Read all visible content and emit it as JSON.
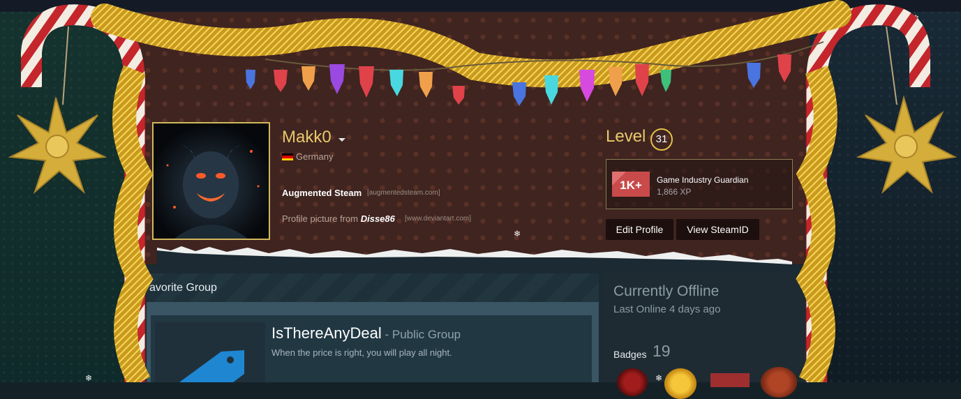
{
  "profile": {
    "persona_name": "Makk0",
    "country": "Germany",
    "summary_title": "Augmented Steam",
    "summary_title_link": "[augmentedsteam.com]",
    "profile_picture_prefix": "Profile picture from",
    "profile_picture_artist": "Disse86",
    "profile_picture_link": "[www.deviantart.com]"
  },
  "level": {
    "label": "Level",
    "value": "31"
  },
  "featured_badge": {
    "icon_text": "1K+",
    "name": "Game Industry Guardian",
    "xp": "1,866 XP"
  },
  "buttons": {
    "edit_profile": "Edit Profile",
    "view_steamid": "View SteamID"
  },
  "favorite_group": {
    "section_title": "avorite Group",
    "name": "IsThereAnyDeal",
    "type": " - Public Group",
    "description": "When the price is right, you will play all night."
  },
  "status": {
    "state": "Currently Offline",
    "last_online": "Last Online 4 days ago"
  },
  "badges": {
    "label": "Badges",
    "count": "19"
  },
  "colors": {
    "accent_gold": "#e7c96b",
    "header_brown": "#3f2420",
    "content_bg": "#1b2a33"
  },
  "icons": {
    "snowflake": "❄"
  }
}
